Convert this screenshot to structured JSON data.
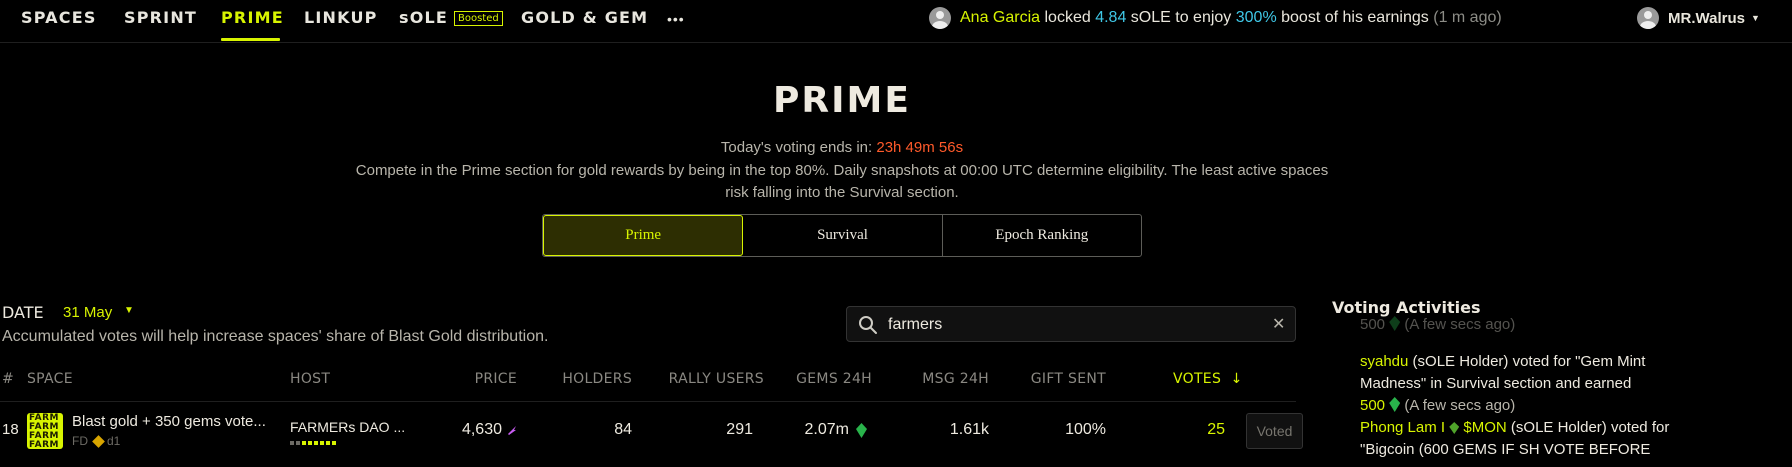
{
  "nav": {
    "items": [
      "SPACES",
      "SPRINT",
      "PRIME",
      "LINKUP",
      "sOLE",
      "GOLD & GEM"
    ],
    "boosted_badge": "Boosted",
    "more": "•••",
    "active": "PRIME"
  },
  "activity_banner": {
    "name": "Ana Garcia",
    "text_locked": "locked",
    "amount": "4.84",
    "text_sole": "sOLE to enjoy",
    "boost": "300%",
    "text_rest": "boost of his earnings",
    "time": "(1 m ago)"
  },
  "user": {
    "name": "MR.Walrus"
  },
  "hero": {
    "title": "PRIME",
    "deadline_label": "Today's voting ends in:",
    "countdown": "23h 49m 56s",
    "description": "Compete in the Prime section for gold rewards by being in the top 80%. Daily snapshots at 00:00 UTC determine eligibility. The least active spaces risk falling into the Survival section."
  },
  "tabs": [
    {
      "label": "Prime",
      "active": true
    },
    {
      "label": "Survival",
      "active": false
    },
    {
      "label": "Epoch Ranking",
      "active": false
    }
  ],
  "date": {
    "label": "DATE",
    "value": "31 May",
    "note": "Accumulated votes will help increase spaces' share of Blast Gold distribution."
  },
  "search": {
    "value": "farmers",
    "placeholder": ""
  },
  "table": {
    "headers": {
      "rank": "#",
      "space": "SPACE",
      "host": "HOST",
      "price": "PRICE",
      "holders": "HOLDERS",
      "rally": "RALLY USERS",
      "gems": "GEMS 24H",
      "msg": "MSG 24H",
      "gift": "GIFT SENT",
      "votes": "VOTES"
    },
    "rows": [
      {
        "rank": "18",
        "space_thumb": [
          "FARM",
          "FARM",
          "FARM",
          "FARM"
        ],
        "space_name": "Blast gold + 350 gems vote...",
        "space_sub": "FD",
        "space_sub2": "d1",
        "host": "FARMERs DAO ...",
        "price": "4,630",
        "holders": "84",
        "rally": "291",
        "gems": "2.07m",
        "msg": "1.61k",
        "gift": "100%",
        "votes": "25",
        "action": "Voted"
      }
    ]
  },
  "panel": {
    "title": "Voting Activities",
    "faded": {
      "amount": "500",
      "time": "(A few secs ago)"
    },
    "activities": [
      {
        "user": "syahdu",
        "role": "(sOLE Holder) voted for \"Gem Mint Madness\" in Survival section and earned",
        "amount": "500",
        "time": "(A few secs ago)"
      },
      {
        "user": "Phong Lam I",
        "ticker": "$MON",
        "role": "(sOLE Holder) voted",
        "text": "for \"Bigcoin (600 GEMS IF SH VOTE BEFORE"
      }
    ]
  },
  "colors": {
    "accent": "#d8f400",
    "cyan": "#3fc7e6",
    "countdown": "#ff5a2a",
    "gem": "#29b34b"
  }
}
